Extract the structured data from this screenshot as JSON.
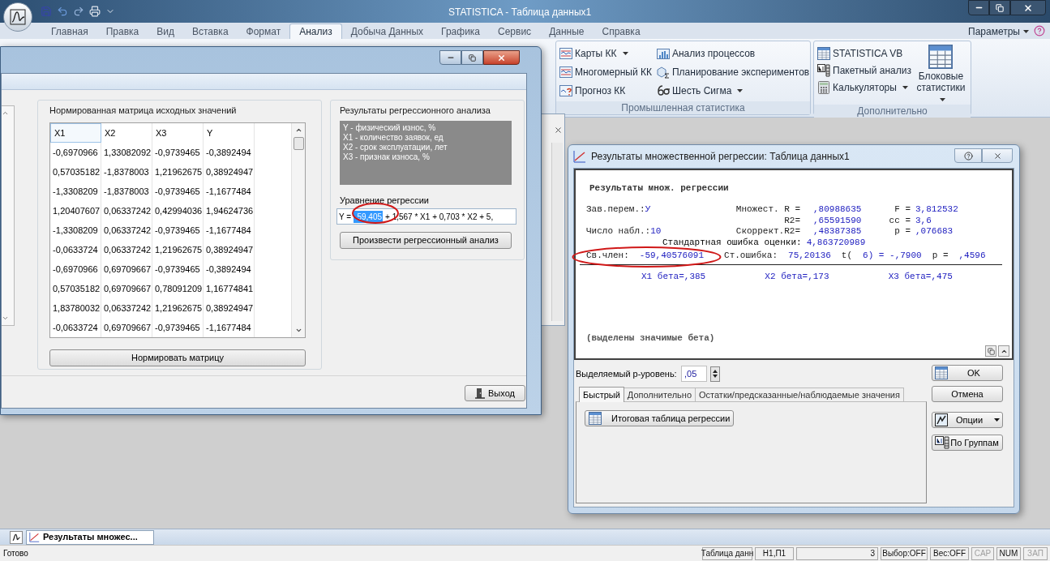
{
  "title_bar": {
    "title": "STATISTICA - Таблица данных1"
  },
  "ribbon": {
    "tabs": [
      {
        "label": "Главная",
        "selected": false
      },
      {
        "label": "Правка",
        "selected": false
      },
      {
        "label": "Вид",
        "selected": false
      },
      {
        "label": "Вставка",
        "selected": false
      },
      {
        "label": "Формат",
        "selected": false
      },
      {
        "label": "Анализ",
        "selected": true
      },
      {
        "label": "Добыча Данных",
        "selected": false
      },
      {
        "label": "Графика",
        "selected": false
      },
      {
        "label": "Сервис",
        "selected": false
      },
      {
        "label": "Данные",
        "selected": false
      },
      {
        "label": "Справка",
        "selected": false
      }
    ],
    "options_label": "Параметры",
    "groups": [
      {
        "label": "Промышленная статистика",
        "items": [
          {
            "label": "Карты КК",
            "dropdown": true
          },
          {
            "label": "Многомерный КК",
            "dropdown": false
          },
          {
            "label": "Прогноз КК",
            "dropdown": false
          },
          {
            "label": "Анализ процессов",
            "dropdown": false
          },
          {
            "label": "Планирование экспериментов",
            "dropdown": false
          },
          {
            "label": "Шесть Сигма",
            "dropdown": true
          }
        ]
      },
      {
        "label": "Дополнительно",
        "items": [
          {
            "label": "STATISTICA VB",
            "dropdown": false
          },
          {
            "label": "Пакетный анализ",
            "dropdown": false
          },
          {
            "label": "Калькуляторы",
            "dropdown": true
          }
        ],
        "large_item": {
          "label": "Блоковые статистики",
          "dropdown": true
        }
      }
    ]
  },
  "normalize_window": {
    "matrix_group": {
      "title": "Нормированная матрица исходных значений",
      "columns": [
        "X1",
        "X2",
        "X3",
        "Y"
      ],
      "rows": [
        [
          "-0,6970966",
          "1,33082092",
          "-0,9739465",
          "-0,3892494"
        ],
        [
          "0,57035182",
          "-1,8378003",
          "1,21962675",
          "0,38924947"
        ],
        [
          "-1,3308209",
          "-1,8378003",
          "-0,9739465",
          "-1,1677484"
        ],
        [
          "1,20407607",
          "0,06337242",
          "0,42994036",
          "1,94624736"
        ],
        [
          "-1,3308209",
          "0,06337242",
          "-0,9739465",
          "-1,1677484"
        ],
        [
          "-0,0633724",
          "0,06337242",
          "1,21962675",
          "0,38924947"
        ],
        [
          "-0,6970966",
          "0,69709667",
          "-0,9739465",
          "-0,3892494"
        ],
        [
          "0,57035182",
          "0,69709667",
          "0,78091209",
          "1,16774841"
        ],
        [
          "1,83780032",
          "0,06337242",
          "1,21962675",
          "0,38924947"
        ],
        [
          "-0,0633724",
          "0,69709667",
          "-0,9739465",
          "-1,1677484"
        ]
      ],
      "button": "Нормировать матрицу"
    },
    "results_group": {
      "title": "Результаты регрессионного анализа",
      "variables": [
        "Y - физический износ, %",
        "X1 - количество заявок, ед",
        "X2 - срок эксплуатации, лет",
        "X3 - признак износа, %"
      ],
      "equation_label": "Уравнение регрессии",
      "equation": {
        "start": "Y =",
        "selected": "-59,405",
        "rest": "+ 1,567 * X1 + 0,703 * X2 + 5,"
      },
      "button": "Произвести регрессионный анализ"
    },
    "exit_button": "Выход"
  },
  "regression_dialog": {
    "title": "Результаты множественной регрессии: Таблица данных1",
    "output": {
      "heading": "Результаты множ. регрессии",
      "stats": [
        {
          "left": {
            "label": "Зав.перем.:",
            "value": "У"
          },
          "middle": {
            "label": "Множест. R =",
            "value": ",80988635"
          },
          "right": {
            "label": "F =",
            "value": "3,812532"
          }
        },
        {
          "middle": {
            "label": "R2=",
            "value": ",65591590"
          },
          "right": {
            "label": "cc =",
            "value": "3,6"
          }
        },
        {
          "left": {
            "label": "Число набл.:",
            "value": "10"
          },
          "middle": {
            "label": "Скоррект.R2=",
            "value": ",48387385"
          },
          "right": {
            "label": "p =",
            "value": ",076683"
          }
        }
      ],
      "std_error": {
        "label": "Стандартная ошибка оценки:",
        "value": "4,863720989"
      },
      "intercept": [
        {
          "text": "Св.член:",
          "kind": "label"
        },
        {
          "text": "-59,40576091",
          "kind": "value"
        },
        {
          "text": "Ст.ошибка:",
          "kind": "label"
        },
        {
          "text": "75,20136",
          "kind": "value"
        },
        {
          "text": "t(",
          "kind": "label"
        },
        {
          "text": "6) = -,7900",
          "kind": "value"
        },
        {
          "text": "p =",
          "kind": "label"
        },
        {
          "text": ",4596",
          "kind": "value"
        }
      ],
      "betas": [
        "X1 бета=,385",
        "X2 бета=,173",
        "X3 бета=,475"
      ],
      "note": "(выделены значимые бета)"
    },
    "p_level": {
      "label": "Выделяемый р-уровень:",
      "value": ",05"
    },
    "tabs": [
      {
        "label": "Быстрый",
        "selected": true
      },
      {
        "label": "Дополнительно",
        "selected": false
      },
      {
        "label": "Остатки/предсказанные/наблюдаемые значения",
        "selected": false
      }
    ],
    "quick_button": "Итоговая таблица регрессии",
    "side_buttons": [
      {
        "label": "OK",
        "kind": "icon"
      },
      {
        "label": "Отмена",
        "kind": "plain"
      },
      {
        "label": "Опции",
        "kind": "menu"
      },
      {
        "label": "По Группам",
        "kind": "icon"
      }
    ]
  },
  "document_tab": "Результаты множес...",
  "status_bar": {
    "message": "Готово",
    "panels": [
      {
        "text": "Таблица данн",
        "disabled": false
      },
      {
        "text": "Н1,П1",
        "disabled": false
      },
      {
        "text": "3",
        "disabled": false
      },
      {
        "text": "Выбор:OFF",
        "disabled": false
      },
      {
        "text": "Вес:OFF",
        "disabled": false
      },
      {
        "text": "CAP",
        "disabled": true
      },
      {
        "text": "NUM",
        "disabled": false
      },
      {
        "text": "ЗАП",
        "disabled": true
      }
    ]
  }
}
